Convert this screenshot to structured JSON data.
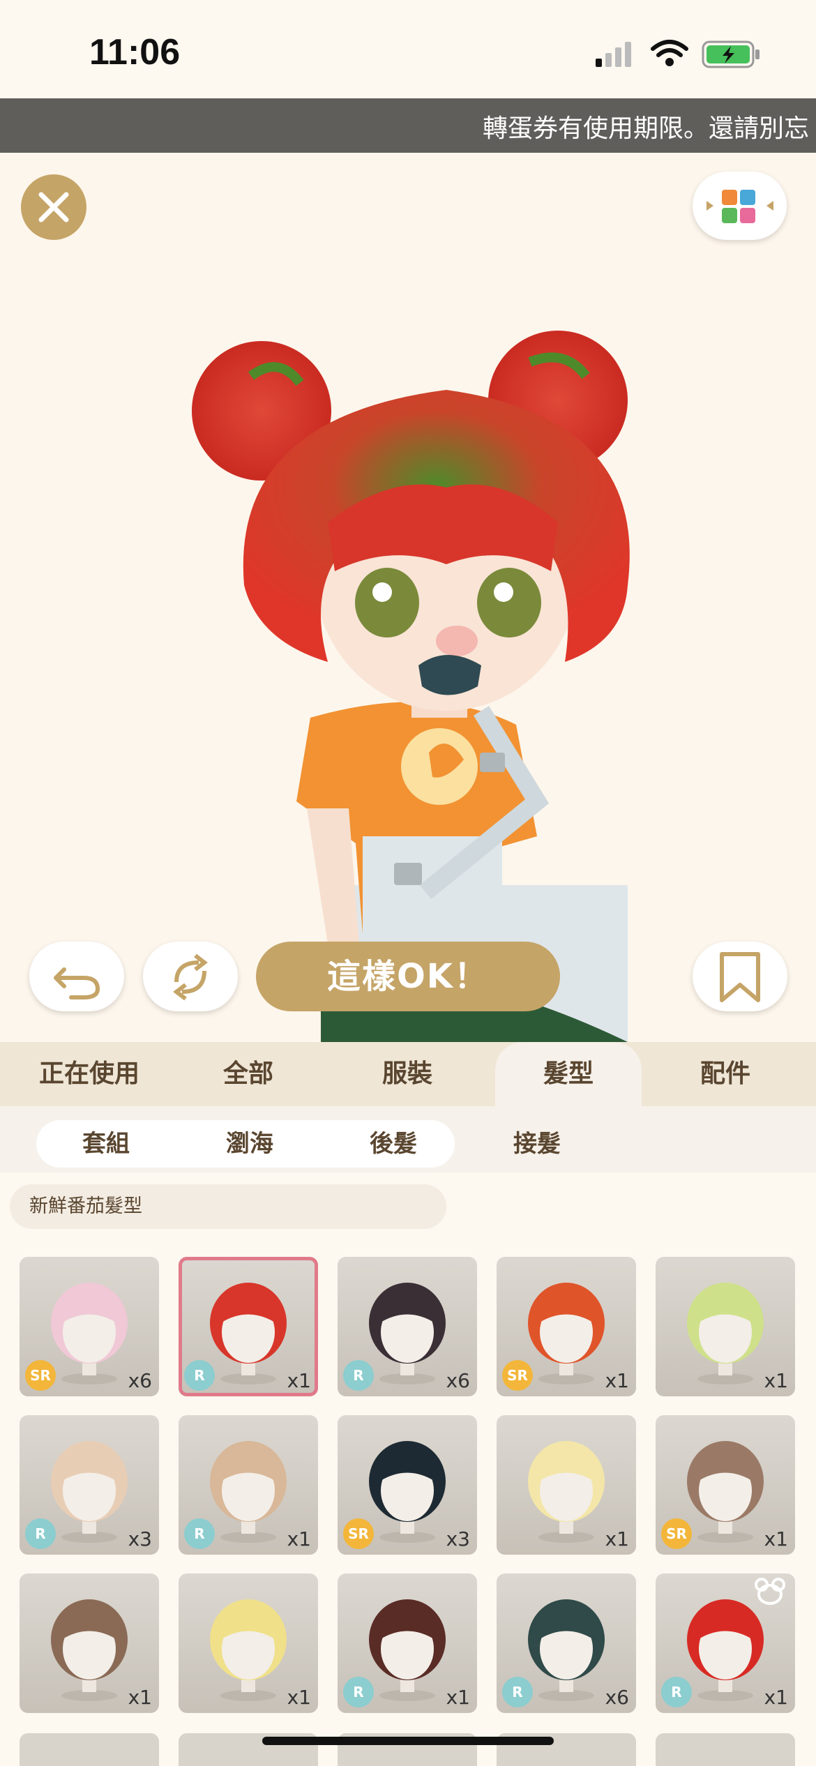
{
  "status": {
    "time": "11:06"
  },
  "ticker": {
    "text": "轉蛋券有使用期限。還請別忘"
  },
  "actions": {
    "ok_label": "這樣OK！"
  },
  "categories": [
    {
      "label": "正在使用",
      "active": false
    },
    {
      "label": "全部",
      "active": false
    },
    {
      "label": "服裝",
      "active": false
    },
    {
      "label": "髮型",
      "active": true
    },
    {
      "label": "配件",
      "active": false
    }
  ],
  "subcategories": [
    {
      "label": "套組",
      "active": true
    },
    {
      "label": "瀏海",
      "active": false
    },
    {
      "label": "後髮",
      "active": false
    },
    {
      "label": "接髮",
      "active": false
    }
  ],
  "set_name": "新鮮番茄髮型",
  "items": [
    {
      "rarity": "SR",
      "qty": "x6",
      "hair": "#f0c8d6"
    },
    {
      "rarity": "R",
      "qty": "x1",
      "hair": "#d8362a",
      "selected": true
    },
    {
      "rarity": "R",
      "qty": "x6",
      "hair": "#3b2f36"
    },
    {
      "rarity": "SR",
      "qty": "x1",
      "hair": "#e0542a"
    },
    {
      "rarity": "",
      "qty": "x1",
      "hair": "#cfe08a"
    },
    {
      "rarity": "R",
      "qty": "x3",
      "hair": "#e8cdb5"
    },
    {
      "rarity": "R",
      "qty": "x1",
      "hair": "#d8b898"
    },
    {
      "rarity": "SR",
      "qty": "x3",
      "hair": "#1e2a33"
    },
    {
      "rarity": "",
      "qty": "x1",
      "hair": "#f3e6a8"
    },
    {
      "rarity": "SR",
      "qty": "x1",
      "hair": "#9a7a66"
    },
    {
      "rarity": "",
      "qty": "x1",
      "hair": "#8a6a55"
    },
    {
      "rarity": "",
      "qty": "x1",
      "hair": "#f0e08a"
    },
    {
      "rarity": "R",
      "qty": "x1",
      "hair": "#5a2c26"
    },
    {
      "rarity": "R",
      "qty": "x6",
      "hair": "#2f4a48"
    },
    {
      "rarity": "R",
      "qty": "x1",
      "hair": "#d82a24"
    }
  ],
  "colors": {
    "accent": "#c5a467",
    "sr": "#f3b63a",
    "r": "#8ccdcf"
  }
}
